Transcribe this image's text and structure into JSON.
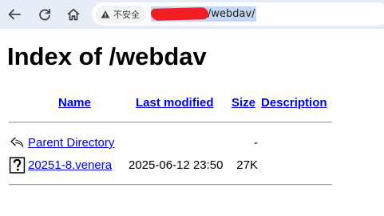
{
  "browser": {
    "security_label": "不安全",
    "url_path": "/webdav/"
  },
  "page": {
    "title": "Index of /webdav",
    "columns": {
      "name": "Name",
      "last_modified": "Last modified",
      "size": "Size",
      "description": "Description"
    },
    "parent": {
      "label": "Parent Directory",
      "size": "-"
    },
    "files": [
      {
        "name": "20251-8.venera",
        "modified": "2025-06-12 23:50",
        "size": "27K",
        "description": ""
      }
    ]
  },
  "colors": {
    "toolbar": "#e7edf6",
    "link": "#0000ee",
    "selection": "#c6d7f6",
    "redaction": "#ee1f25"
  },
  "icons": [
    "back-arrow-icon",
    "reload-icon",
    "home-icon",
    "warning-icon",
    "parent-directory-icon",
    "unknown-file-icon"
  ]
}
